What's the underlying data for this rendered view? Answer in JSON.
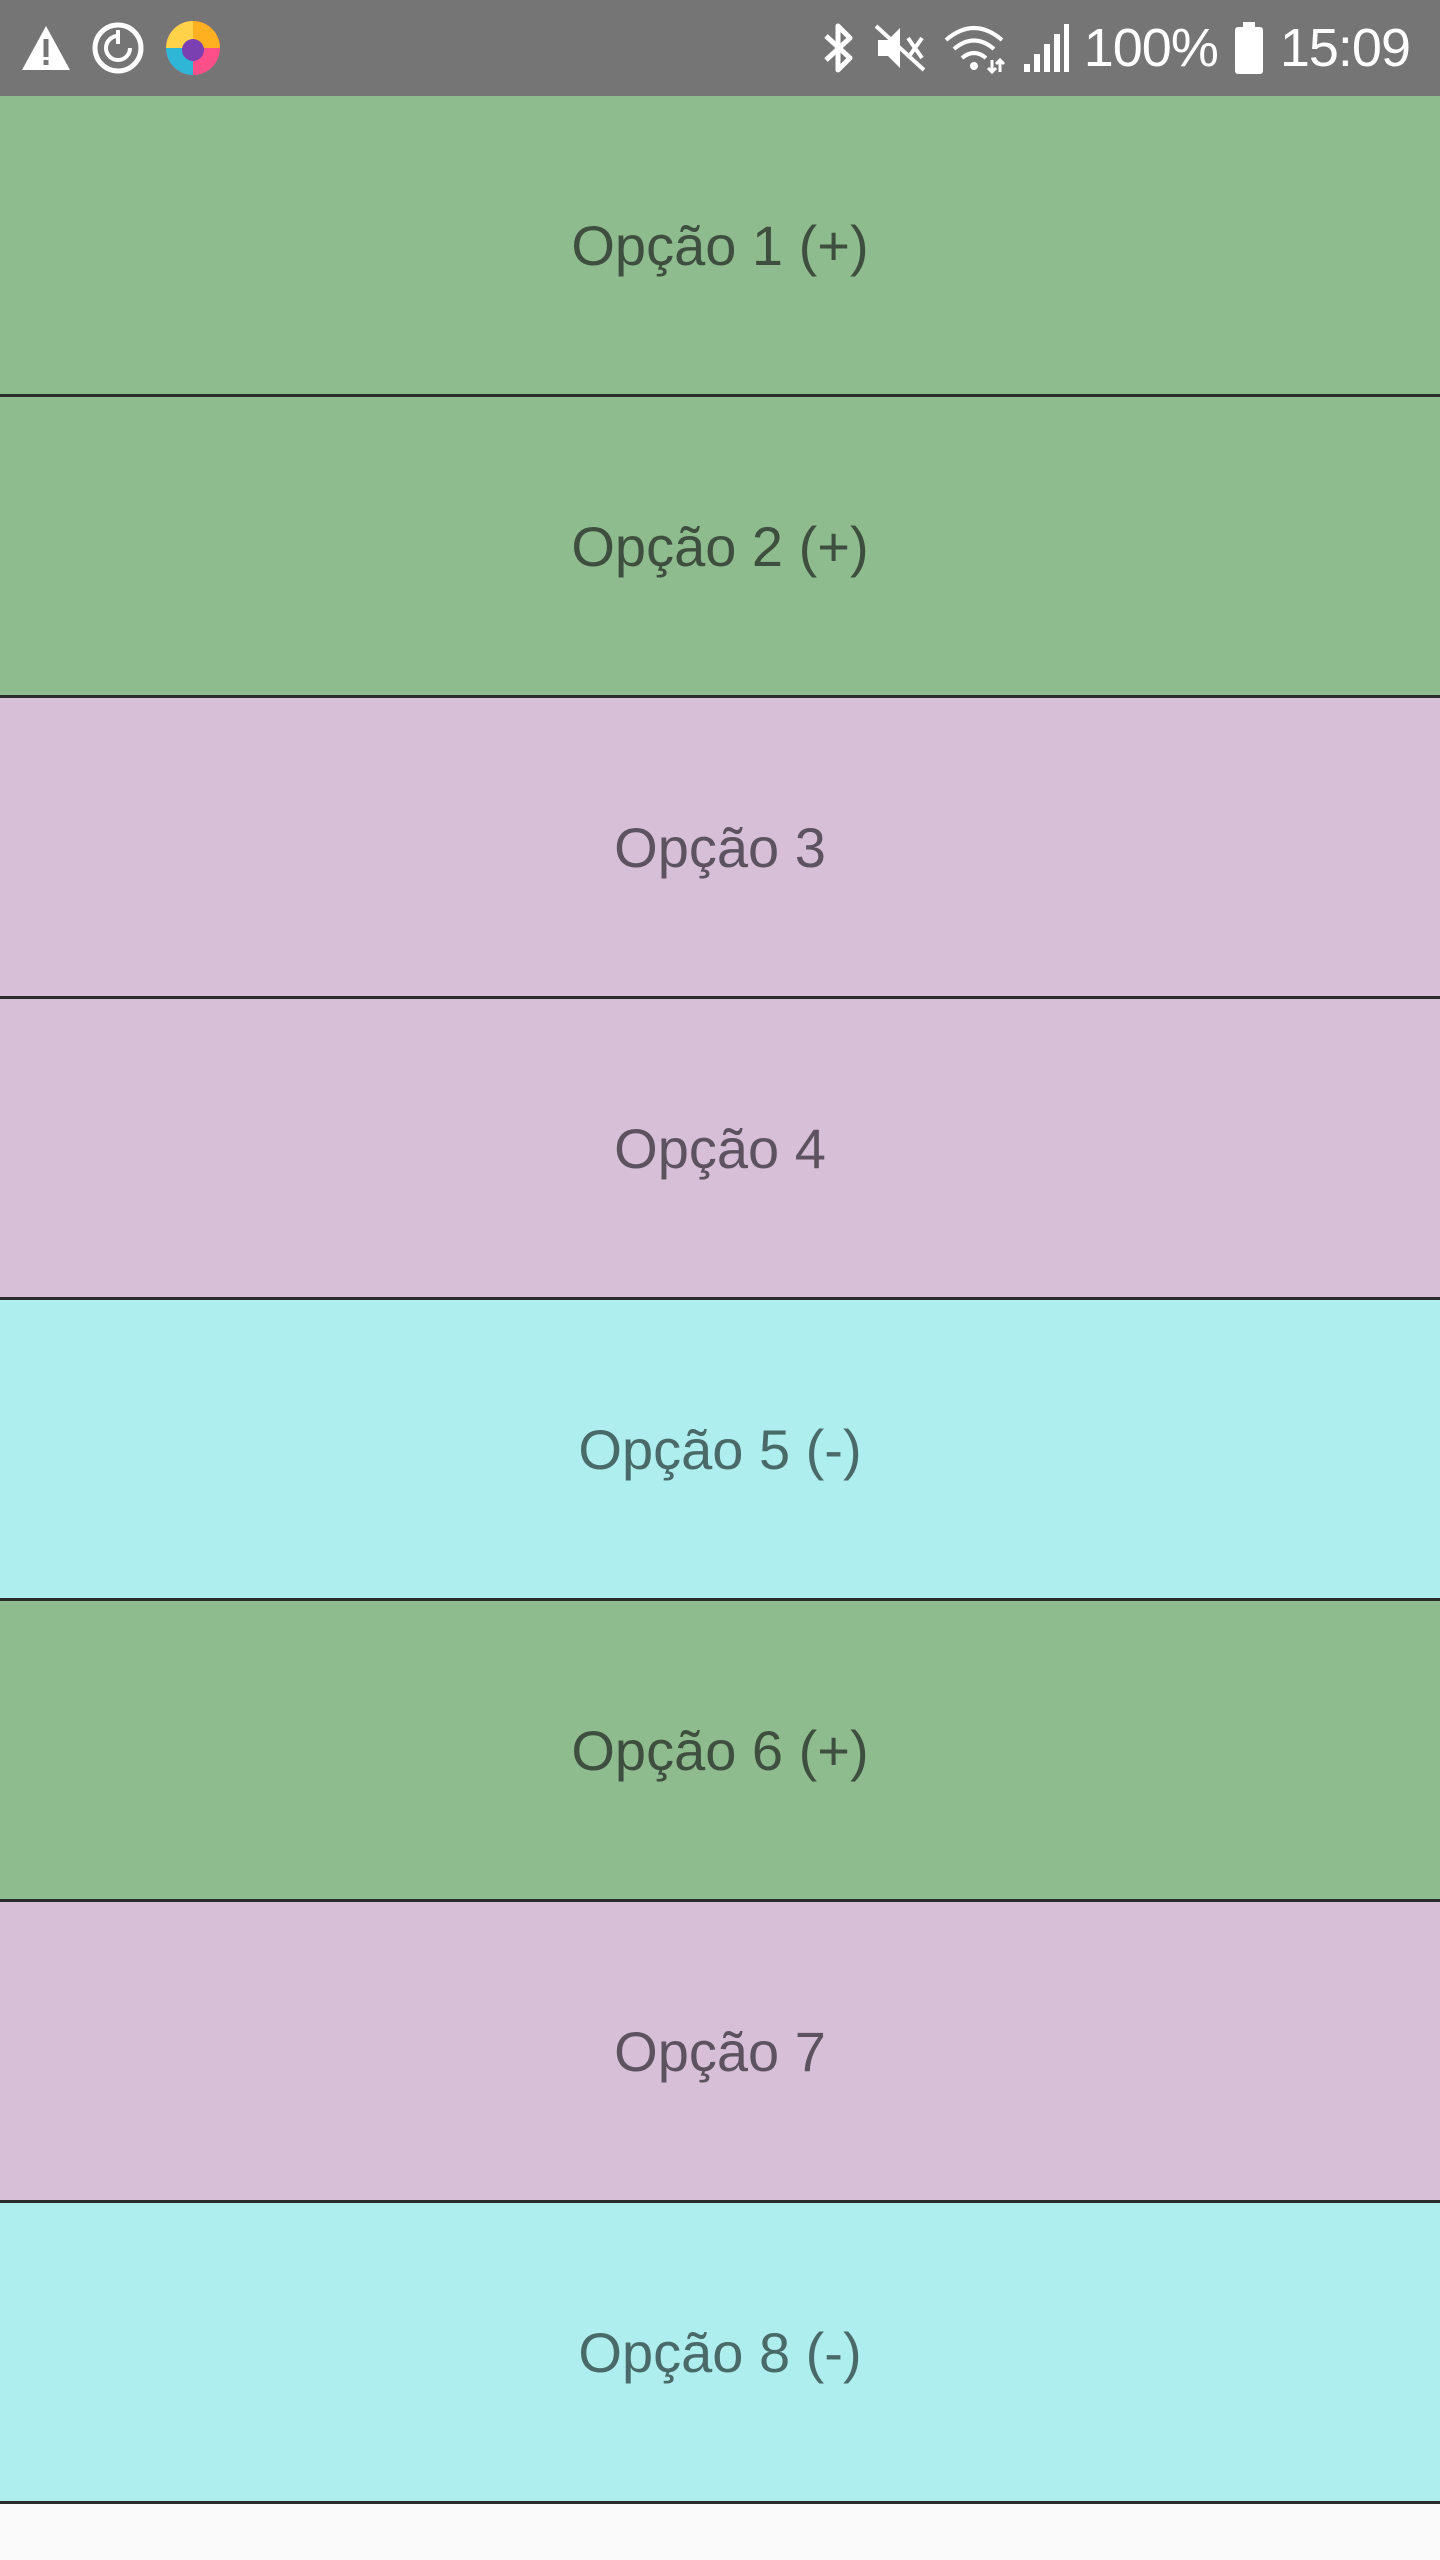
{
  "status_bar": {
    "left_icons": [
      "warning-icon",
      "sync-icon",
      "browser-app-icon"
    ],
    "right_icons": [
      "bluetooth-icon",
      "mute-icon",
      "wifi-icon",
      "signal-icon",
      "battery-icon"
    ],
    "battery_percent": "100%",
    "time": "15:09",
    "background_color": "#757575"
  },
  "options": [
    {
      "label": "Opção 1 (+)",
      "color": "#8fbc8f"
    },
    {
      "label": "Opção 2 (+)",
      "color": "#8fbc8f"
    },
    {
      "label": "Opção 3",
      "color": "#d8bfd8"
    },
    {
      "label": "Opção 4",
      "color": "#d8bfd8"
    },
    {
      "label": "Opção 5 (-)",
      "color": "#afeeee"
    },
    {
      "label": "Opção 6 (+)",
      "color": "#8fbc8f"
    },
    {
      "label": "Opção 7",
      "color": "#d8bfd8"
    },
    {
      "label": "Opção 8 (-)",
      "color": "#afeeee"
    }
  ]
}
